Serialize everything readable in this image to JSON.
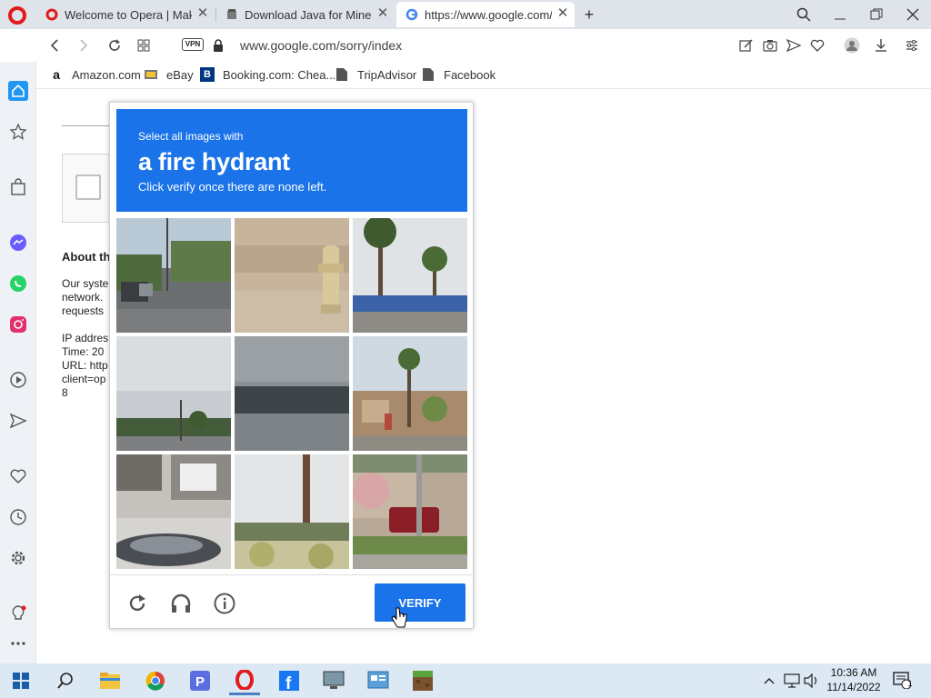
{
  "tabs": [
    {
      "title": "Welcome to Opera | Make",
      "icon": "opera-icon"
    },
    {
      "title": "Download Java for Minecra",
      "icon": "java-icon"
    },
    {
      "title": "https://www.google.com/s",
      "icon": "google-icon",
      "active": true
    }
  ],
  "address_bar": {
    "vpn_label": "VPN",
    "url": "www.google.com/sorry/index"
  },
  "bookmarks": [
    {
      "label": "Amazon.com",
      "icon": "amazon-icon"
    },
    {
      "label": "eBay",
      "icon": "ebay-icon"
    },
    {
      "label": "Booking.com: Chea...",
      "icon": "booking-icon"
    },
    {
      "label": "TripAdvisor",
      "icon": "page-icon"
    },
    {
      "label": "Facebook",
      "icon": "page-icon"
    }
  ],
  "sidebar": [
    "home-icon",
    "star-icon",
    "shopping-bag-icon",
    "messenger-icon",
    "whatsapp-icon",
    "instagram-icon",
    "player-icon",
    "send-icon",
    "heart-icon",
    "history-icon",
    "settings-icon",
    "lightbulb-icon",
    "more-icon"
  ],
  "page": {
    "heading": "About th",
    "lines": [
      "Our syste",
      "network.",
      "requests",
      "",
      "IP addres",
      "Time: 20",
      "URL: http",
      "client=op",
      "8"
    ]
  },
  "captcha": {
    "line1": "Select all images with",
    "line2": "a fire hydrant",
    "line3": "Click verify once there are none left.",
    "verify_label": "VERIFY",
    "tiles": [
      "street-with-cars",
      "sand-hydrant",
      "palm-trees-gas-station",
      "cloudy-sky-trees",
      "blurry-dark-trees",
      "house-palm-trees",
      "car-stairs",
      "palm-trunk-fence",
      "red-suv-house"
    ]
  },
  "taskbar": {
    "apps": [
      "start-icon",
      "search-icon",
      "file-explorer-icon",
      "chrome-icon",
      "p-app-icon",
      "opera-icon",
      "facebook-icon",
      "computer-icon",
      "control-panel-icon",
      "minecraft-icon"
    ],
    "time": "10:36 AM",
    "date": "11/14/2022",
    "notification_count": "1"
  },
  "colors": {
    "captcha_blue": "#1a73e8",
    "opera_red": "#e21b1b",
    "taskbar": "#dce8f4"
  }
}
